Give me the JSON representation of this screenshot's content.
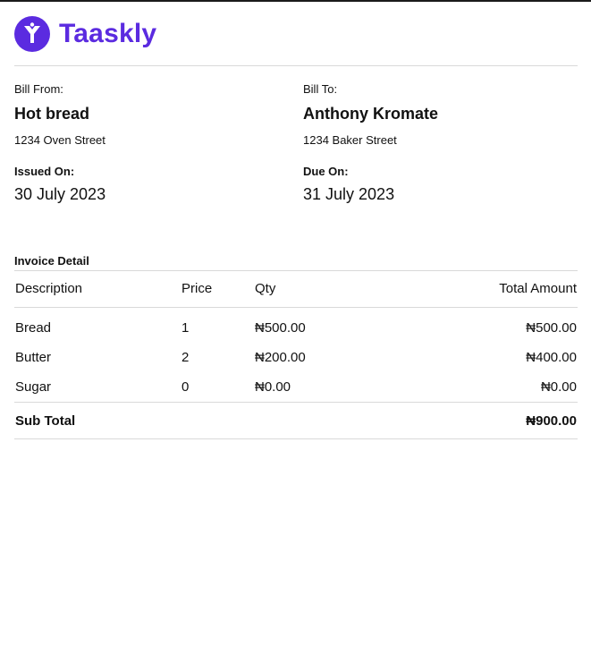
{
  "brand": {
    "name": "Taaskly",
    "color": "#5b2be0",
    "icon": "taaskly-logo-icon"
  },
  "bill_from": {
    "label": "Bill From:",
    "name": "Hot bread",
    "address": "1234 Oven Street"
  },
  "bill_to": {
    "label": "Bill To:",
    "name": "Anthony Kromate",
    "address": "1234 Baker Street"
  },
  "issued": {
    "label": "Issued On:",
    "date": "30 July 2023"
  },
  "due": {
    "label": "Due On:",
    "date": "31 July 2023"
  },
  "invoice": {
    "title": "Invoice Detail",
    "headers": {
      "description": "Description",
      "price": "Price",
      "qty": "Qty",
      "total": "Total Amount"
    },
    "rows": [
      {
        "description": "Bread",
        "price": "1",
        "qty": "₦500.00",
        "total": "₦500.00"
      },
      {
        "description": "Butter",
        "price": "2",
        "qty": "₦200.00",
        "total": "₦400.00"
      },
      {
        "description": "Sugar",
        "price": "0",
        "qty": "₦0.00",
        "total": "₦0.00"
      }
    ],
    "subtotal": {
      "label": "Sub Total",
      "value": "₦900.00"
    }
  }
}
